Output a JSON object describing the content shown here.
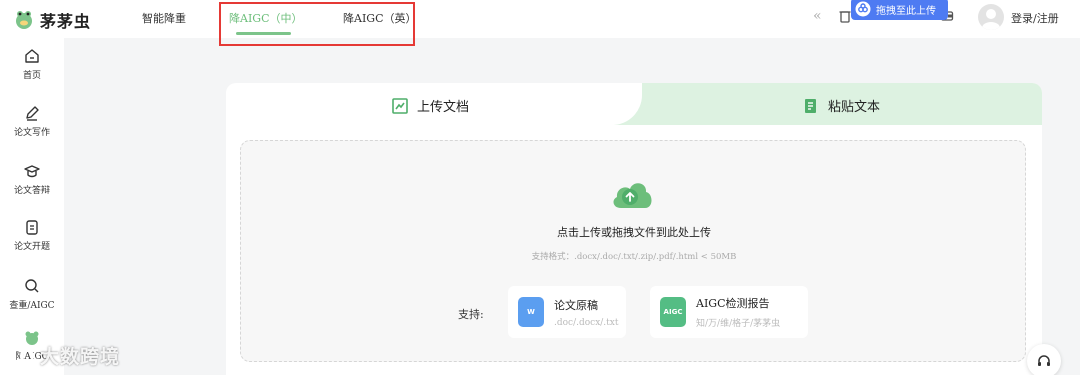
{
  "header": {
    "logo_text": "茅茅虫",
    "nav": [
      {
        "label": "智能降重"
      },
      {
        "label": "降AIGC（中）",
        "active": true
      },
      {
        "label": "降AIGC（英）"
      }
    ],
    "drag_chip_label": "拖拽至此上传",
    "login_label": "登录/注册",
    "collapse_icon": "«"
  },
  "sidebar": {
    "items": [
      {
        "label": "首页",
        "icon": "home-icon"
      },
      {
        "label": "论文写作",
        "icon": "pen-icon"
      },
      {
        "label": "论文答辩",
        "icon": "graduation-cap-icon"
      },
      {
        "label": "论文开题",
        "icon": "clipboard-icon"
      },
      {
        "label": "查重/AIGC",
        "icon": "search-icon"
      }
    ],
    "partial_label": "降AIGC"
  },
  "tabs": {
    "upload_label": "上传文档",
    "paste_label": "粘贴文本"
  },
  "dropzone": {
    "title": "点击上传或拖拽文件到此处上传",
    "hint": "支持格式：.docx/.doc/.txt/.zip/.pdf/.html < 50MB",
    "support_label": "支持:",
    "cards": [
      {
        "title": "论文原稿",
        "sub": ".doc/.docx/.txt",
        "icon_text": "W"
      },
      {
        "title": "AIGC检测报告",
        "sub": "知/万/维/格子/茅茅虫",
        "icon_text": "AIGC"
      }
    ]
  },
  "watermark": "大数跨境",
  "colors": {
    "accent_green": "#6dbe7b",
    "tab_bg": "#ddf2e1",
    "chip_blue": "#4e7bf2",
    "highlight_red": "#e53935"
  }
}
